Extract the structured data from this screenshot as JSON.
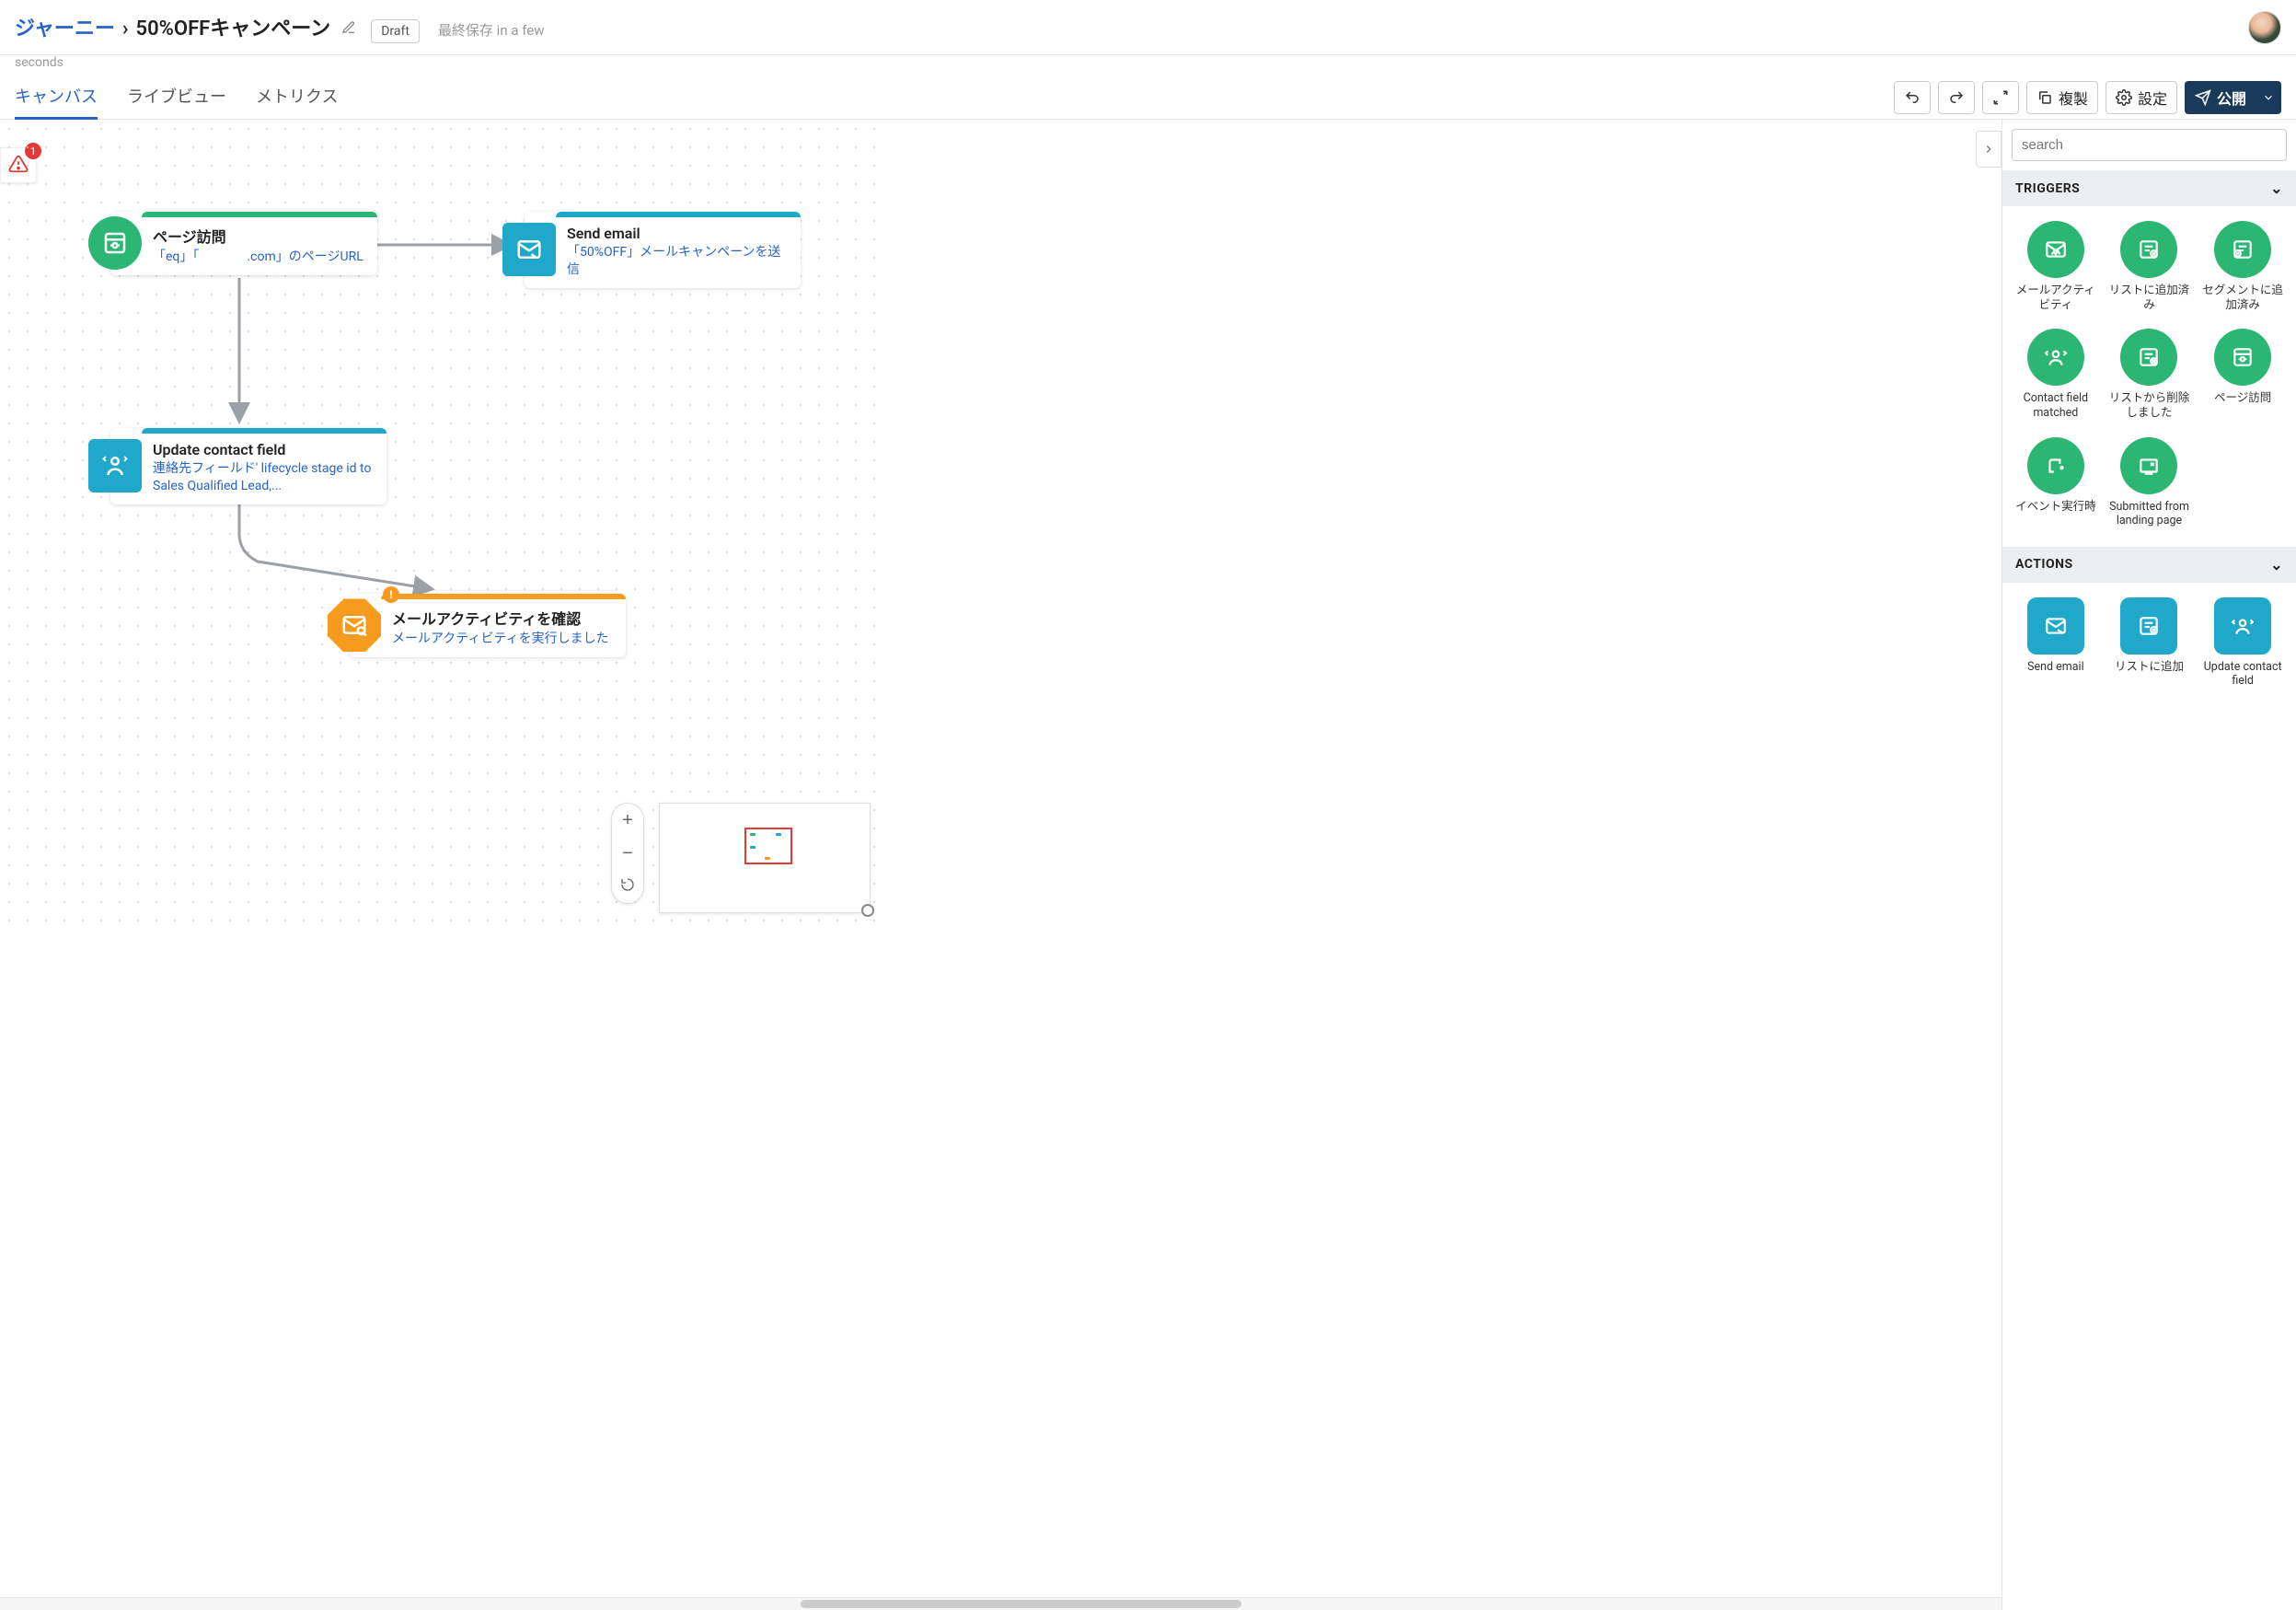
{
  "header": {
    "breadcrumb_root": "ジャーニー",
    "breadcrumb_sep": "›",
    "title": "50%OFFキャンペーン",
    "draft_badge": "Draft",
    "last_saved_prefix": "最終保存",
    "last_saved_value": "in a few",
    "last_saved_suffix": "seconds"
  },
  "tabs": {
    "canvas": "キャンバス",
    "live": "ライブビュー",
    "metrics": "メトリクス"
  },
  "toolbar": {
    "duplicate": "複製",
    "settings": "設定",
    "publish": "公開"
  },
  "warning": {
    "count": "1"
  },
  "nodes": {
    "page_visit": {
      "title": "ページ訪問",
      "sub_line1": "「eq」「",
      "sub_line2": ".com」のページURL"
    },
    "send_email": {
      "title": "Send email",
      "sub": "「50%OFF」メールキャンペーンを送信"
    },
    "update_contact": {
      "title": "Update contact field",
      "sub": "連絡先フィールド' lifecycle stage id to Sales Qualified Lead,..."
    },
    "mail_activity": {
      "title": "メールアクティビティを確認",
      "sub": "メールアクティビティを実行しました",
      "badge": "!"
    }
  },
  "sidebar": {
    "search_placeholder": "search",
    "triggers_header": "TRIGGERS",
    "actions_header": "ACTIONS",
    "triggers": [
      {
        "label": "メールアクティビティ",
        "icon": "mail-activity"
      },
      {
        "label": "リストに追加済み",
        "icon": "list-added"
      },
      {
        "label": "セグメントに追加済み",
        "icon": "segment-added"
      },
      {
        "label": "Contact field matched",
        "icon": "contact-field"
      },
      {
        "label": "リストから削除しました",
        "icon": "list-removed"
      },
      {
        "label": "ページ訪問",
        "icon": "page-visit"
      },
      {
        "label": "イベント実行時",
        "icon": "event-run"
      },
      {
        "label": "Submitted from landing page",
        "icon": "landing-page"
      }
    ],
    "actions": [
      {
        "label": "Send email",
        "icon": "send-email"
      },
      {
        "label": "リストに追加",
        "icon": "list-add"
      },
      {
        "label": "Update contact field",
        "icon": "update-contact"
      }
    ]
  },
  "colors": {
    "green": "#2bb673",
    "teal": "#1fa8c9",
    "orange": "#f79b1e",
    "primary": "#1a3a5c",
    "link": "#2563c9"
  }
}
